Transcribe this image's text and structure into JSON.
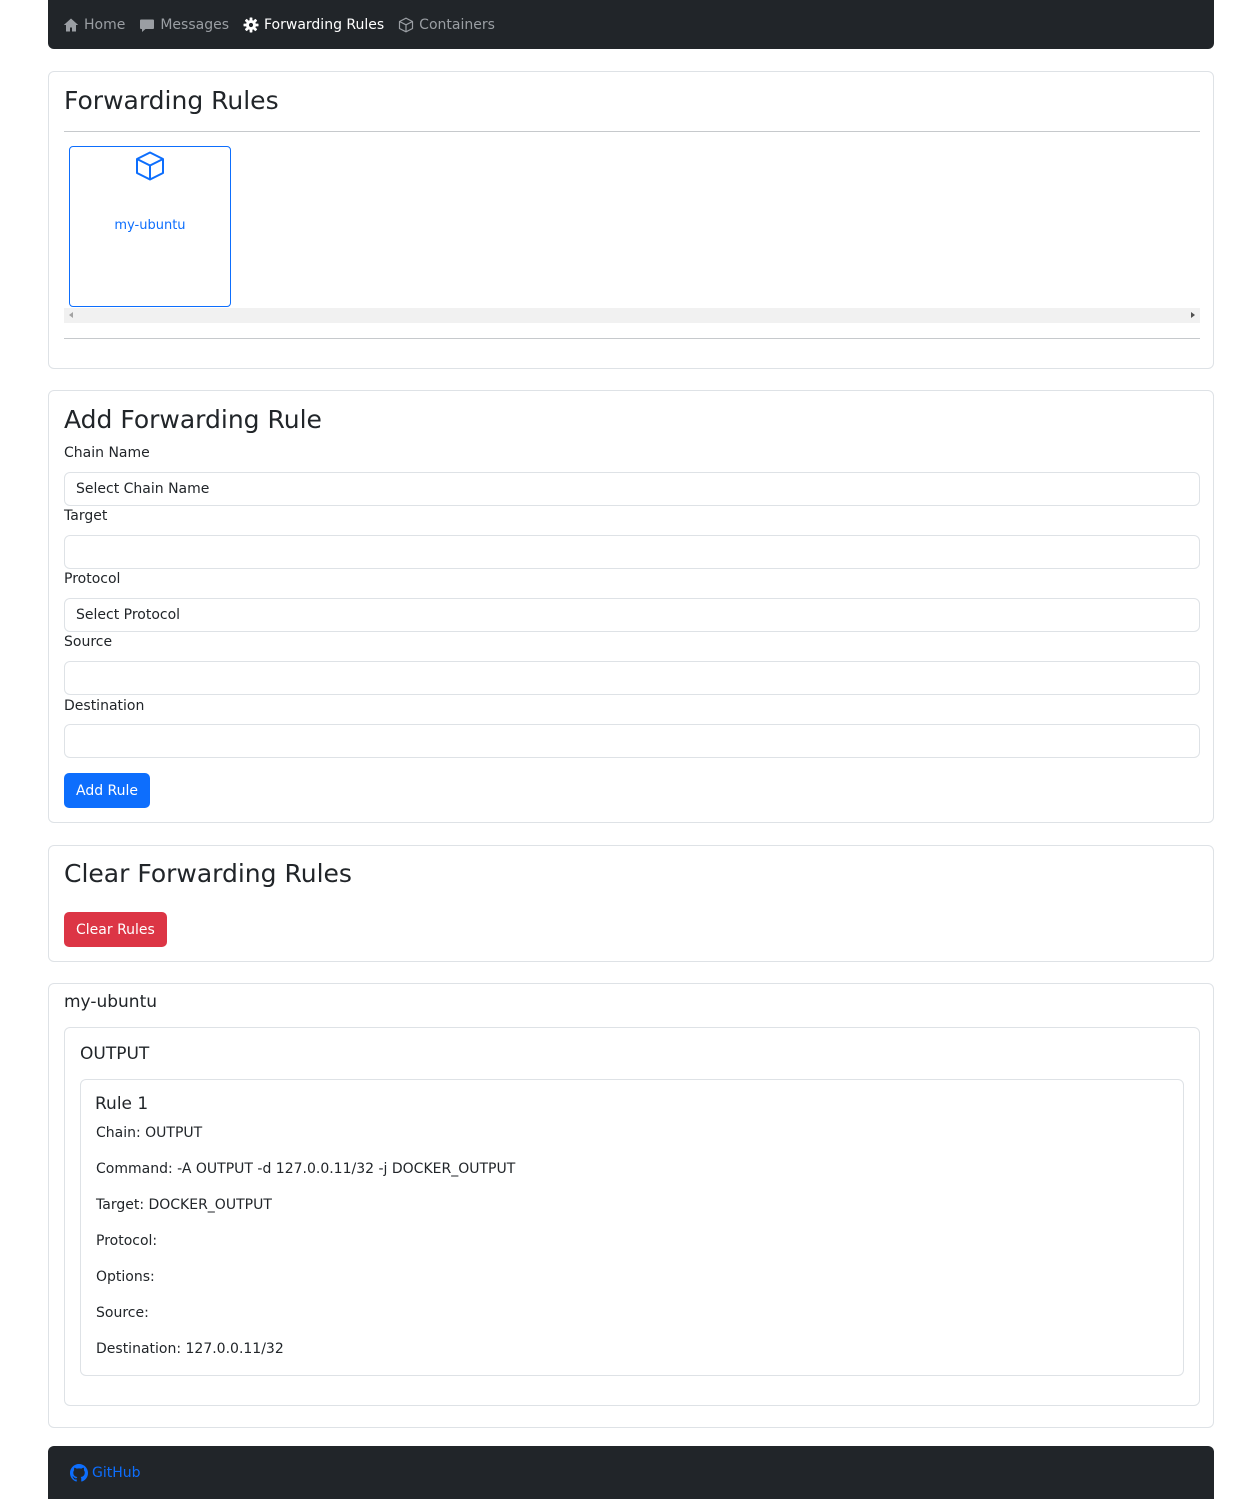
{
  "navbar": {
    "items": [
      {
        "label": "Home",
        "icon": "house-icon"
      },
      {
        "label": "Messages",
        "icon": "chat-icon"
      },
      {
        "label": "Forwarding Rules",
        "icon": "gear-icon",
        "active": true
      },
      {
        "label": "Containers",
        "icon": "box-icon"
      }
    ]
  },
  "forwarding": {
    "title": "Forwarding Rules",
    "containers": [
      {
        "name": "my-ubuntu",
        "icon": "box-icon"
      }
    ]
  },
  "add_rule": {
    "title": "Add Forwarding Rule",
    "fields": {
      "chain_name": {
        "label": "Chain Name",
        "placeholder": "Select Chain Name",
        "value": ""
      },
      "target": {
        "label": "Target",
        "value": ""
      },
      "protocol": {
        "label": "Protocol",
        "placeholder": "Select Protocol",
        "value": ""
      },
      "source": {
        "label": "Source",
        "value": ""
      },
      "destination": {
        "label": "Destination",
        "value": ""
      }
    },
    "submit_label": "Add Rule"
  },
  "clear": {
    "title": "Clear Forwarding Rules",
    "button_label": "Clear Rules"
  },
  "rules_view": {
    "container_name": "my-ubuntu",
    "chain": "OUTPUT",
    "rules": [
      {
        "title": "Rule 1",
        "chain": "Chain: OUTPUT",
        "command": "Command: -A OUTPUT -d 127.0.0.11/32 -j DOCKER_OUTPUT",
        "target": "Target: DOCKER_OUTPUT",
        "protocol": "Protocol:",
        "options": "Options:",
        "source": "Source:",
        "destination": "Destination: 127.0.0.11/32"
      }
    ]
  },
  "footer": {
    "link_label": "GitHub",
    "icon": "github-icon"
  },
  "colors": {
    "navbar_bg": "#212529",
    "primary": "#0d6efd",
    "danger": "#dc3545",
    "border": "#dee2e6"
  }
}
